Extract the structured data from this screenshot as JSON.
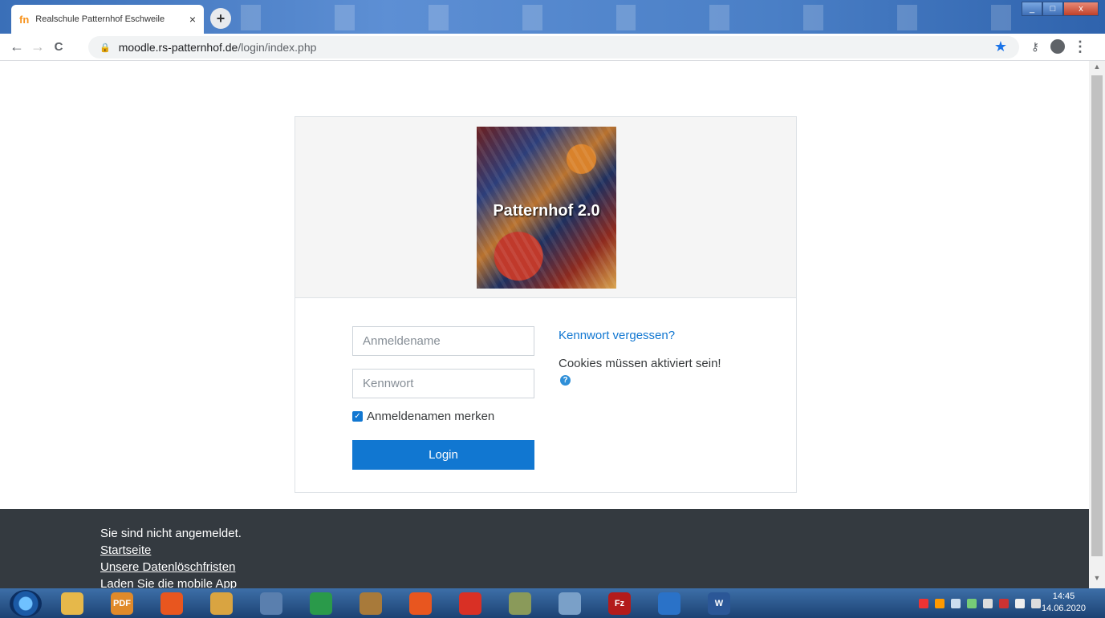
{
  "browser": {
    "tab_title": "Realschule Patternhof Eschweile",
    "tab_favicon": "fn",
    "close_glyph": "×",
    "new_tab_glyph": "+",
    "url_domain": "moodle.rs-patternhof.de",
    "url_path": "/login/index.php",
    "nav": {
      "back": "←",
      "forward": "→",
      "reload": "C"
    },
    "icons": {
      "lock": "🔒",
      "star": "★",
      "key": "⚷",
      "menu": "⋮"
    },
    "window_controls": {
      "minimize": "_",
      "maximize": "□",
      "close": "x"
    }
  },
  "login": {
    "logo_text": "Patternhof 2.0",
    "username_placeholder": "Anmeldename",
    "password_placeholder": "Kennwort",
    "remember_label": "Anmeldenamen merken",
    "remember_checked": true,
    "login_button": "Login",
    "forgot_password": "Kennwort vergessen?",
    "cookies_notice": "Cookies müssen aktiviert sein!",
    "help_icon": "?"
  },
  "footer": {
    "status": "Sie sind nicht angemeldet.",
    "links": [
      "Startseite",
      "Unsere Datenlöschfristen",
      "Laden Sie die mobile App"
    ]
  },
  "taskbar": {
    "apps": [
      {
        "name": "file-explorer",
        "color": "#e6b84a",
        "label": ""
      },
      {
        "name": "pdf-app",
        "color": "#e08a2a",
        "label": "PDF"
      },
      {
        "name": "firefox",
        "color": "#e8561f",
        "label": ""
      },
      {
        "name": "folder",
        "color": "#d9a441",
        "label": ""
      },
      {
        "name": "document-app",
        "color": "#5a7fae",
        "label": ""
      },
      {
        "name": "green-app",
        "color": "#2a9a4a",
        "label": ""
      },
      {
        "name": "tool-app",
        "color": "#a87a3a",
        "label": ""
      },
      {
        "name": "firefox-2",
        "color": "#e8561f",
        "label": ""
      },
      {
        "name": "chrome",
        "color": "#d93025",
        "label": ""
      },
      {
        "name": "calc-app",
        "color": "#8a9a5a",
        "label": ""
      },
      {
        "name": "box-app",
        "color": "#7aa0c8",
        "label": ""
      },
      {
        "name": "filezilla",
        "color": "#b31b1b",
        "label": "Fz"
      },
      {
        "name": "blue-app",
        "color": "#2a72c8",
        "label": ""
      },
      {
        "name": "word",
        "color": "#2b5797",
        "label": "W"
      }
    ],
    "time": "14:45",
    "date": "14.06.2020"
  }
}
